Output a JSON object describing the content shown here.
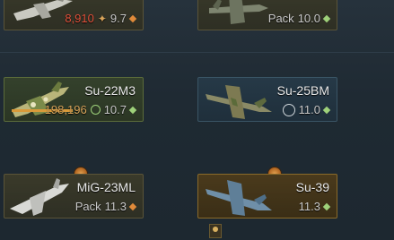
{
  "cards": {
    "top_left": {
      "rp_value": "8,910",
      "br": "9.7"
    },
    "top_right": {
      "rank_label": "Pack",
      "br": "10.0"
    },
    "su22m3": {
      "name": "Su-22M3",
      "rp_value": "198,196",
      "br": "10.7"
    },
    "su25bm": {
      "name": "Su-25BM",
      "br": "11.0"
    },
    "mig23ml": {
      "name": "MiG-23ML",
      "rank_label": "Pack",
      "br": "11.3"
    },
    "su39": {
      "name": "Su-39",
      "br": "11.3"
    }
  },
  "colors": {
    "accent_orange": "#e08a3a",
    "accent_green": "#9ed17a",
    "rp_red": "#e0503a"
  },
  "icons": [
    "eagle-icon",
    "diamond-icon",
    "rp-icon",
    "premium-g-icon",
    "medal-badge-icon",
    "crew-icon"
  ]
}
